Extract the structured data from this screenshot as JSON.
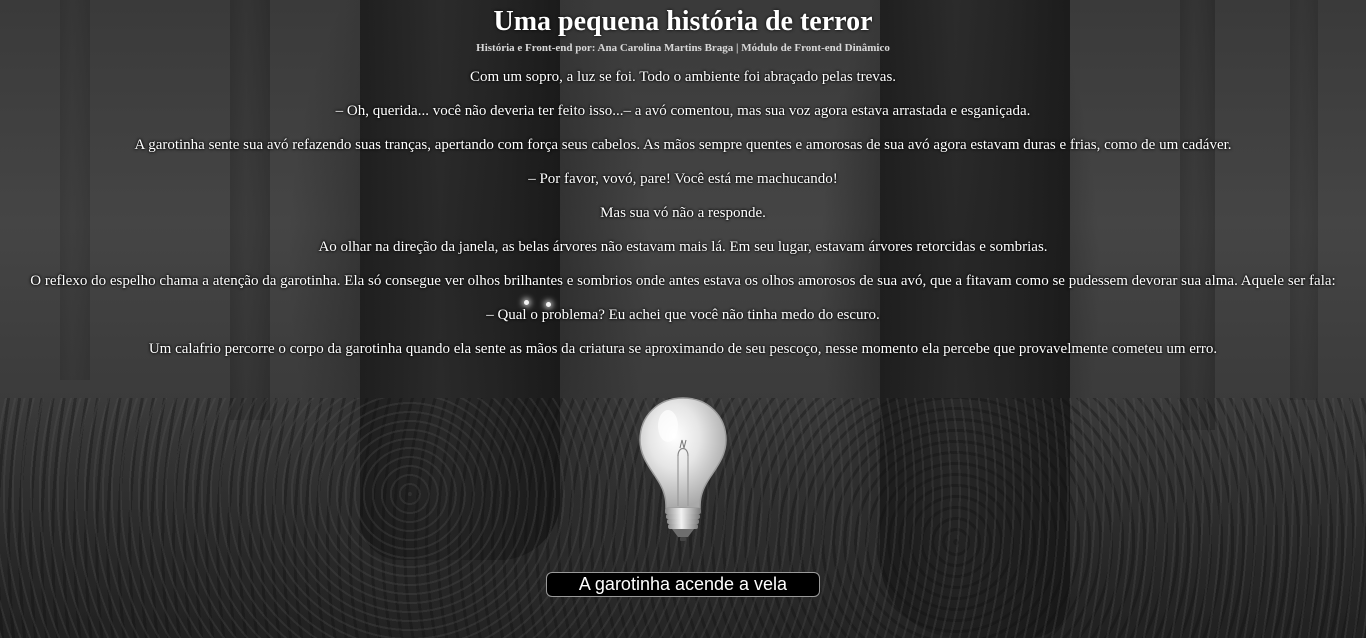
{
  "header": {
    "title": "Uma pequena história de terror",
    "credits": "História e Front-end por: Ana Carolina Martins Braga | Módulo de Front-end Dinâmico"
  },
  "story": {
    "paragraphs": [
      "Com um sopro, a luz se foi. Todo o ambiente foi abraçado pelas trevas.",
      "– Oh, querida... você não deveria ter feito isso...– a avó comentou, mas sua voz agora estava arrastada e esganiçada.",
      "A garotinha sente sua avó refazendo suas tranças, apertando com força seus cabelos. As mãos sempre quentes e amorosas de sua avó agora estavam duras e frias, como de um cadáver.",
      "– Por favor, vovó, pare! Você está me machucando!",
      "Mas sua vó não a responde.",
      "Ao olhar na direção da janela, as belas árvores não estavam mais lá. Em seu lugar, estavam árvores retorcidas e sombrias.",
      "O reflexo do espelho chama a atenção da garotinha. Ela só consegue ver olhos brilhantes e sombrios onde antes estava os olhos amorosos de sua avó, que a fitavam como se pudessem devorar sua alma. Aquele ser fala:",
      "– Qual o problema? Eu achei que você não tinha medo do escuro.",
      "Um calafrio percorre o corpo da garotinha quando ela sente as mãos da criatura se aproximando de seu pescoço, nesse momento ela percebe que provavelmente cometeu um erro."
    ]
  },
  "image": {
    "icon": "light-bulb-icon",
    "state": "off"
  },
  "action": {
    "label": "A garotinha acende a vela"
  },
  "colors": {
    "text": "#ffffff",
    "button_bg": "#000000",
    "button_border": "#9a9a9a"
  }
}
